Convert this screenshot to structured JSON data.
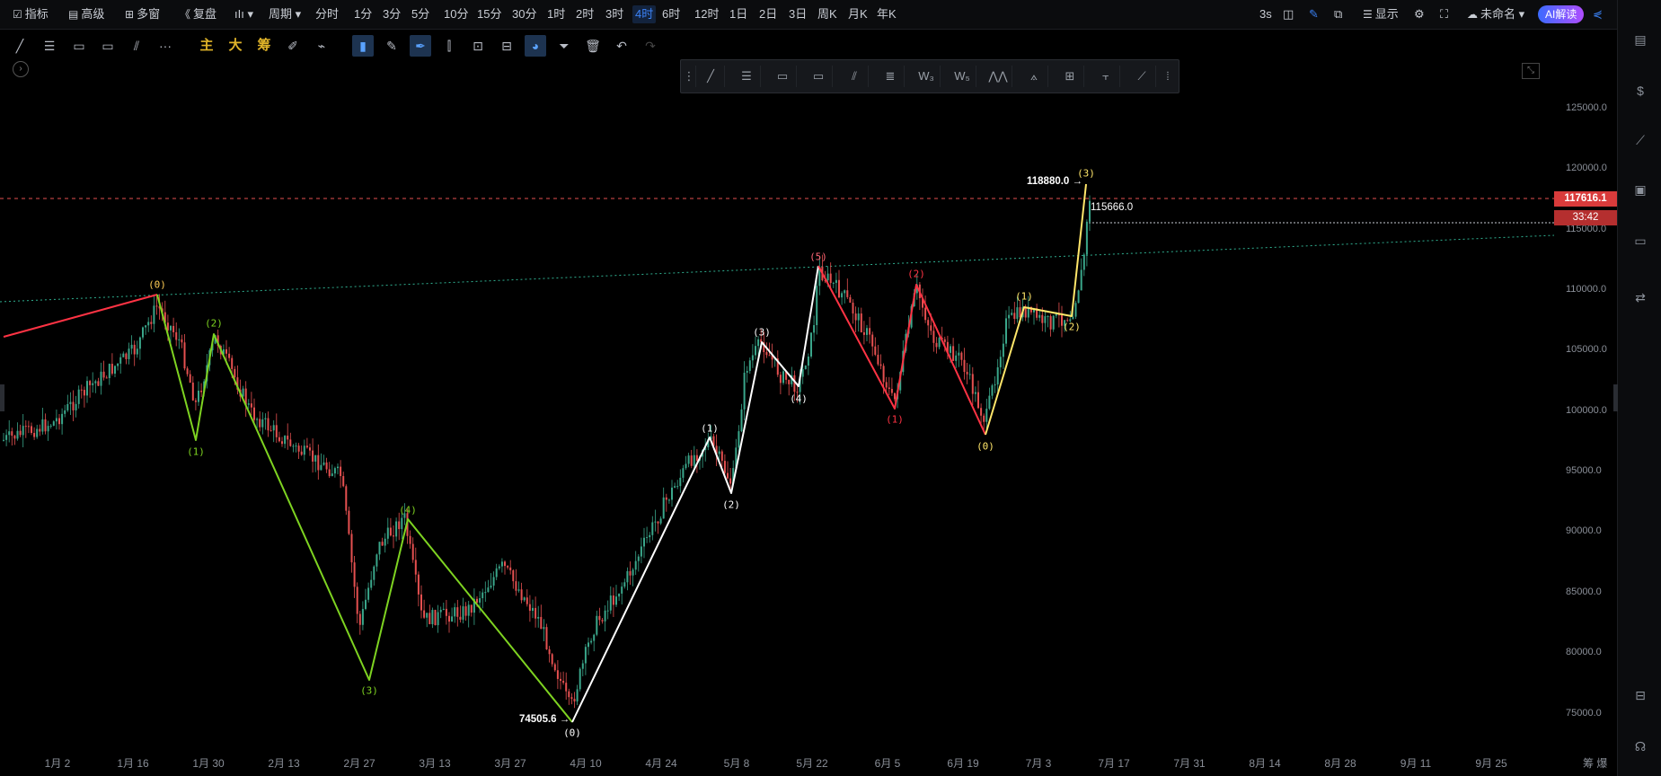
{
  "top": {
    "indicators": "指标",
    "advanced": "高级",
    "multi_window": "多窗",
    "replay": "复盘",
    "period": "周期",
    "intervals": [
      "分时",
      "1分",
      "3分",
      "5分",
      "10分",
      "15分",
      "30分",
      "1时",
      "2时",
      "3时",
      "4时",
      "6时",
      "12时",
      "1日",
      "2日",
      "3日",
      "周K",
      "月K",
      "年K"
    ],
    "active_interval": "4时",
    "refresh": "3s",
    "display": "显示",
    "layout_name": "未命名",
    "ai_button": "AI解读"
  },
  "toolbar2": {
    "main": "主",
    "big": "大",
    "chip": "筹"
  },
  "chart": {
    "price_ticks": [
      "125000.0",
      "120000.0",
      "115000.0",
      "110000.0",
      "105000.0",
      "100000.0",
      "95000.0",
      "90000.0",
      "85000.0",
      "80000.0",
      "75000.0"
    ],
    "date_ticks": [
      "1月 2",
      "1月 16",
      "1月 30",
      "2月 13",
      "2月 27",
      "3月 13",
      "3月 27",
      "4月 10",
      "4月 24",
      "5月 8",
      "5月 22",
      "6月 5",
      "6月 19",
      "7月 3",
      "7月 17",
      "7月 31",
      "8月 14",
      "8月 28",
      "9月 11",
      "9月 25"
    ],
    "last_price": "117616.1",
    "countdown": "33:42",
    "high_annotation": "118880.0",
    "low_annotation": "74505.6",
    "level_annotation": "115666.0",
    "bottom_right_text": "筹 爆",
    "colors": {
      "up": "#3aa68a",
      "down": "#e55050",
      "wave_red": "#ff3344",
      "wave_green": "#7ed321",
      "wave_white": "#ffffff",
      "wave_yellow": "#ffe66a",
      "price_line": "#e55050"
    }
  },
  "wave_labels": {
    "red_top": "(0)",
    "green_1": "(1)",
    "green_2": "(2)",
    "green_3": "(3)",
    "green_4": "(4)",
    "white_0": "(0)",
    "white_1": "(1)",
    "white_2": "(2)",
    "white_3": "(3)",
    "white_4": "(4)",
    "white_5": "(5)",
    "red_1": "(1)",
    "red_2": "(2)",
    "yellow_0": "(0)",
    "yellow_1": "(1)",
    "yellow_2": "(2)",
    "yellow_3": "(3)"
  }
}
